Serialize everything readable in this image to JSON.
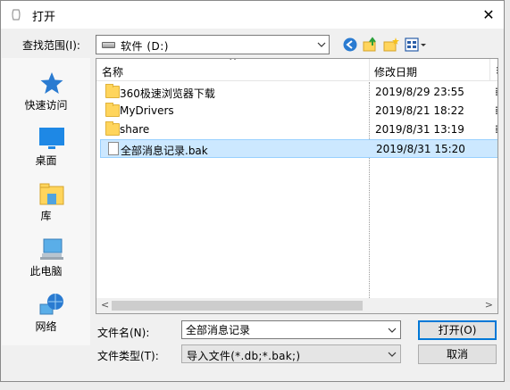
{
  "dialog": {
    "title": "打开",
    "close_glyph": "✕"
  },
  "look_in": {
    "label": "查找范围(I):",
    "value": "软件 (D:)"
  },
  "toolbar": {
    "icons": [
      "back-icon",
      "up-folder-icon",
      "new-folder-icon",
      "view-menu-icon"
    ]
  },
  "places": [
    {
      "label": "快速访问",
      "icon": "star-icon"
    },
    {
      "label": "桌面",
      "icon": "desktop-icon"
    },
    {
      "label": "库",
      "icon": "library-icon"
    },
    {
      "label": "此电脑",
      "icon": "computer-icon"
    },
    {
      "label": "网络",
      "icon": "network-icon"
    }
  ],
  "file_list": {
    "columns": {
      "name": "名称",
      "date": "修改日期"
    },
    "rows": [
      {
        "name": "360极速浏览器下载",
        "date": "2019/8/29 23:55",
        "type": "folder"
      },
      {
        "name": "MyDrivers",
        "date": "2019/8/21 18:22",
        "type": "folder"
      },
      {
        "name": "share",
        "date": "2019/8/31 13:19",
        "type": "folder"
      },
      {
        "name": "全部消息记录.bak",
        "date": "2019/8/31 15:20",
        "type": "file",
        "selected": true
      }
    ]
  },
  "filename": {
    "label": "文件名(N):",
    "value": "全部消息记录"
  },
  "filetype": {
    "label": "文件类型(T):",
    "value": "导入文件(*.db;*.bak;)"
  },
  "buttons": {
    "open": "打开(O)",
    "cancel": "取消"
  },
  "colors": {
    "selection": "#cce8ff",
    "accent": "#0078d7",
    "folder": "#ffd55c"
  }
}
